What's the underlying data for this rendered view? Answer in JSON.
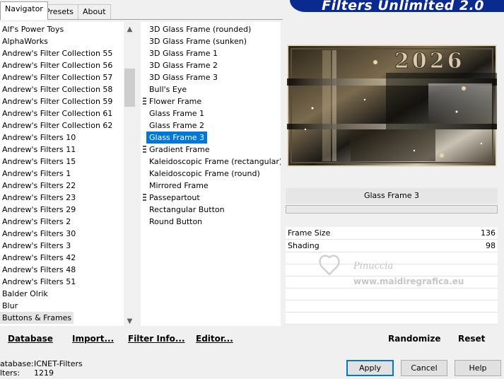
{
  "tabs": [
    "Navigator",
    "Presets",
    "About"
  ],
  "banner_title": "Filters Unlimited 2.0",
  "categories": [
    "Alf's Power Toys",
    "AlphaWorks",
    "Andrew's Filter Collection 55",
    "Andrew's Filter Collection 56",
    "Andrew's Filter Collection 57",
    "Andrew's Filter Collection 58",
    "Andrew's Filter Collection 59",
    "Andrew's Filter Collection 61",
    "Andrew's Filter Collection 62",
    "Andrew's Filters 10",
    "Andrew's Filters 11",
    "Andrew's Filters 15",
    "Andrew's Filters 1",
    "Andrew's Filters 22",
    "Andrew's Filters 23",
    "Andrew's Filters 29",
    "Andrew's Filters 2",
    "Andrew's Filters 30",
    "Andrew's Filters 3",
    "Andrew's Filters 42",
    "Andrew's Filters 48",
    "Andrew's Filters 51",
    "Balder Olrik",
    "Blur",
    "Buttons & Frames"
  ],
  "selected_category": "Buttons & Frames",
  "filters": [
    {
      "label": "3D Glass Frame (rounded)",
      "marker": false
    },
    {
      "label": "3D Glass Frame (sunken)",
      "marker": false
    },
    {
      "label": "3D Glass Frame 1",
      "marker": false
    },
    {
      "label": "3D Glass Frame 2",
      "marker": false
    },
    {
      "label": "3D Glass Frame 3",
      "marker": false
    },
    {
      "label": "Bull's Eye",
      "marker": false
    },
    {
      "label": "Flower Frame",
      "marker": true
    },
    {
      "label": "Glass Frame 1",
      "marker": false
    },
    {
      "label": "Glass Frame 2",
      "marker": false
    },
    {
      "label": "Glass Frame 3",
      "marker": false
    },
    {
      "label": "Gradient Frame",
      "marker": true
    },
    {
      "label": "Kaleidoscopic Frame (rectangular)",
      "marker": false
    },
    {
      "label": "Kaleidoscopic Frame (round)",
      "marker": false
    },
    {
      "label": "Mirrored Frame",
      "marker": false
    },
    {
      "label": "Passepartout",
      "marker": true
    },
    {
      "label": "Rectangular Button",
      "marker": false
    },
    {
      "label": "Round Button",
      "marker": false
    }
  ],
  "selected_filter": "Glass Frame 3",
  "preview": {
    "overlay_text": "2026"
  },
  "params": [
    {
      "name": "Frame Size",
      "value": "136"
    },
    {
      "name": "Shading",
      "value": "98"
    }
  ],
  "watermark": {
    "line1": "Pinuccia",
    "line2": "www.maidiregrafica.eu"
  },
  "toolbar": {
    "database": "Database",
    "import": "Import...",
    "filter_info": "Filter Info...",
    "editor": "Editor...",
    "randomize": "Randomize",
    "reset": "Reset"
  },
  "status": {
    "database_label": "atabase:",
    "database_value": "ICNET-Filters",
    "filters_label": "lters:",
    "filters_value": "1219"
  },
  "buttons": {
    "apply": "Apply",
    "cancel": "Cancel",
    "help": "Help"
  },
  "colors": {
    "banner": "#0b2a8f",
    "selection": "#0078d7"
  }
}
